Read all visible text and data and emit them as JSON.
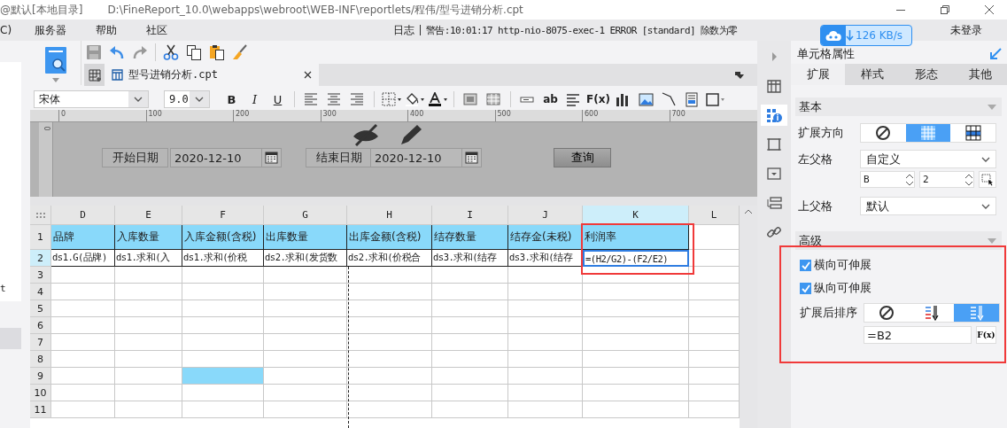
{
  "title_bar": {
    "workspace": "@默认[本地目录]",
    "path": "D:\\FineReport_10.0\\webapps\\webroot\\WEB-INF\\reportlets/程伟/型号进销分析.cpt"
  },
  "menu": [
    "C)",
    "服务器",
    "帮助",
    "社区"
  ],
  "log": {
    "label": "日志",
    "message": "警告:10:01:17 http-nio-8075-exec-1 ERROR [standard] 除数为零"
  },
  "upload_badge": {
    "speed": "126 KB/s"
  },
  "login": "未登录",
  "left_panel": {
    "text": "t"
  },
  "toolbar": [
    {
      "kind": "save"
    },
    {
      "kind": "undo"
    },
    {
      "kind": "redo"
    },
    {
      "kind": "separator"
    },
    {
      "kind": "cut"
    },
    {
      "kind": "copy"
    },
    {
      "kind": "paste"
    },
    {
      "kind": "brush"
    }
  ],
  "tabs": [
    {
      "label": "型号进销分析.cpt",
      "selected": true
    }
  ],
  "format_toolbar": {
    "font": "宋体",
    "size": "9.0",
    "items": [
      {
        "kind": "bold",
        "label": "B"
      },
      {
        "kind": "italic",
        "label": "I"
      },
      {
        "kind": "underline",
        "label": "U"
      },
      {
        "kind": "separator"
      },
      {
        "kind": "align-left"
      },
      {
        "kind": "align-center"
      },
      {
        "kind": "align-right"
      },
      {
        "kind": "separator"
      },
      {
        "kind": "border"
      },
      {
        "kind": "fill"
      },
      {
        "kind": "font-color"
      },
      {
        "kind": "separator"
      },
      {
        "kind": "merge"
      },
      {
        "kind": "table"
      },
      {
        "kind": "separator"
      },
      {
        "kind": "textbox"
      },
      {
        "kind": "text",
        "label": "ab"
      },
      {
        "kind": "lines"
      },
      {
        "kind": "text",
        "label": "F(x)"
      },
      {
        "kind": "chart"
      },
      {
        "kind": "image"
      },
      {
        "kind": "slash"
      },
      {
        "kind": "document"
      },
      {
        "kind": "frame"
      }
    ]
  },
  "ruler": [
    "0",
    "100",
    "200",
    "300",
    "400",
    "500",
    "600",
    "700"
  ],
  "vertical_ruler": "0",
  "parameters": [
    {
      "kind": "label",
      "text": "开始日期"
    },
    {
      "kind": "date",
      "value": "2020-12-10"
    },
    {
      "kind": "label",
      "text": "结束日期"
    },
    {
      "kind": "date",
      "value": "2020-12-10"
    },
    {
      "kind": "button",
      "text": "查询"
    }
  ],
  "grid": {
    "columns": [
      {
        "label": "D",
        "selected": false
      },
      {
        "label": "E",
        "selected": false
      },
      {
        "label": "F",
        "selected": false
      },
      {
        "label": "G",
        "selected": false
      },
      {
        "label": "H",
        "selected": false
      },
      {
        "label": "I",
        "selected": false
      },
      {
        "label": "J",
        "selected": false
      },
      {
        "label": "K",
        "selected": true
      },
      {
        "label": "L",
        "selected": false
      }
    ],
    "rows": [
      {
        "label": "1",
        "selected": false,
        "cells": [
          {
            "text": "品牌",
            "selected": false,
            "filled": true
          },
          {
            "text": "入库数量",
            "selected": false,
            "filled": true
          },
          {
            "text": "入库金额(含税)",
            "selected": false,
            "filled": true
          },
          {
            "text": "出库数量",
            "selected": false,
            "filled": true
          },
          {
            "text": "出库金额(含税)",
            "selected": false,
            "filled": true
          },
          {
            "text": "结存数量",
            "selected": false,
            "filled": true
          },
          {
            "text": "结存金(未税)",
            "selected": false,
            "filled": true
          },
          {
            "text": "利润率",
            "selected": false,
            "filled": true
          },
          {
            "selected": false,
            "filled": false
          }
        ]
      },
      {
        "label": "2",
        "selected": true,
        "cells": [
          {
            "text": "ds1.G(品牌)",
            "selected": false,
            "filled": false
          },
          {
            "text": "ds1.求和(入",
            "selected": false,
            "filled": false
          },
          {
            "text": "ds1.求和(价税",
            "selected": false,
            "filled": false
          },
          {
            "text": "ds2.求和(发货数",
            "selected": false,
            "filled": false
          },
          {
            "text": "ds2.求和(价税合",
            "selected": false,
            "filled": false
          },
          {
            "text": "ds3.求和(结存",
            "selected": false,
            "filled": false
          },
          {
            "text": "ds3.求和(结存",
            "selected": false,
            "filled": false
          },
          {
            "text": "=(H2/G2)-(F2/E2)",
            "selected": true,
            "filled": false
          },
          {
            "selected": false,
            "filled": false
          }
        ]
      },
      {
        "label": "3",
        "selected": false,
        "cells": [
          {
            "selected": false,
            "filled": false
          },
          {
            "selected": false,
            "filled": false
          },
          {
            "selected": false,
            "filled": false
          },
          {
            "selected": false,
            "filled": false
          },
          {
            "selected": false,
            "filled": false
          },
          {
            "selected": false,
            "filled": false
          },
          {
            "selected": false,
            "filled": false
          },
          {
            "selected": false,
            "filled": false
          },
          {
            "selected": false,
            "filled": false
          }
        ]
      },
      {
        "label": "4",
        "selected": false,
        "cells": [
          {
            "selected": false,
            "filled": false
          },
          {
            "selected": false,
            "filled": false
          },
          {
            "selected": false,
            "filled": false
          },
          {
            "selected": false,
            "filled": false
          },
          {
            "selected": false,
            "filled": false
          },
          {
            "selected": false,
            "filled": false
          },
          {
            "selected": false,
            "filled": false
          },
          {
            "selected": false,
            "filled": false
          },
          {
            "selected": false,
            "filled": false
          }
        ]
      },
      {
        "label": "5",
        "selected": false,
        "cells": [
          {
            "selected": false,
            "filled": false
          },
          {
            "selected": false,
            "filled": false
          },
          {
            "selected": false,
            "filled": false
          },
          {
            "selected": false,
            "filled": false
          },
          {
            "selected": false,
            "filled": false
          },
          {
            "selected": false,
            "filled": false
          },
          {
            "selected": false,
            "filled": false
          },
          {
            "selected": false,
            "filled": false
          },
          {
            "selected": false,
            "filled": false
          }
        ]
      },
      {
        "label": "6",
        "selected": false,
        "cells": [
          {
            "selected": false,
            "filled": false
          },
          {
            "selected": false,
            "filled": false
          },
          {
            "selected": false,
            "filled": false
          },
          {
            "selected": false,
            "filled": false
          },
          {
            "selected": false,
            "filled": false
          },
          {
            "selected": false,
            "filled": false
          },
          {
            "selected": false,
            "filled": false
          },
          {
            "selected": false,
            "filled": false
          },
          {
            "selected": false,
            "filled": false
          }
        ]
      },
      {
        "label": "7",
        "selected": false,
        "cells": [
          {
            "selected": false,
            "filled": false
          },
          {
            "selected": false,
            "filled": false
          },
          {
            "selected": false,
            "filled": false
          },
          {
            "selected": false,
            "filled": false
          },
          {
            "selected": false,
            "filled": false
          },
          {
            "selected": false,
            "filled": false
          },
          {
            "selected": false,
            "filled": false
          },
          {
            "selected": false,
            "filled": false
          },
          {
            "selected": false,
            "filled": false
          }
        ]
      },
      {
        "label": "8",
        "selected": false,
        "cells": [
          {
            "selected": false,
            "filled": false
          },
          {
            "selected": false,
            "filled": false
          },
          {
            "selected": false,
            "filled": false
          },
          {
            "selected": false,
            "filled": false
          },
          {
            "selected": false,
            "filled": false
          },
          {
            "selected": false,
            "filled": false
          },
          {
            "selected": false,
            "filled": false
          },
          {
            "selected": false,
            "filled": false
          },
          {
            "selected": false,
            "filled": false
          }
        ]
      },
      {
        "label": "9",
        "selected": false,
        "cells": [
          {
            "selected": false,
            "filled": false
          },
          {
            "selected": false,
            "filled": false
          },
          {
            "selected": false,
            "filled": true
          },
          {
            "selected": false,
            "filled": false
          },
          {
            "selected": false,
            "filled": false
          },
          {
            "selected": false,
            "filled": false
          },
          {
            "selected": false,
            "filled": false
          },
          {
            "selected": false,
            "filled": false
          },
          {
            "selected": false,
            "filled": false
          }
        ]
      },
      {
        "label": "10",
        "selected": false,
        "cells": [
          {
            "selected": false,
            "filled": false
          },
          {
            "selected": false,
            "filled": false
          },
          {
            "selected": false,
            "filled": false
          },
          {
            "selected": false,
            "filled": false
          },
          {
            "selected": false,
            "filled": false
          },
          {
            "selected": false,
            "filled": false
          },
          {
            "selected": false,
            "filled": false
          },
          {
            "selected": false,
            "filled": false
          },
          {
            "selected": false,
            "filled": false
          }
        ]
      },
      {
        "label": "11",
        "selected": false,
        "cells": [
          {
            "selected": false,
            "filled": false
          },
          {
            "selected": false,
            "filled": false
          },
          {
            "selected": false,
            "filled": false
          },
          {
            "selected": false,
            "filled": false
          },
          {
            "selected": false,
            "filled": false
          },
          {
            "selected": false,
            "filled": false
          },
          {
            "selected": false,
            "filled": false
          },
          {
            "selected": false,
            "filled": false
          },
          {
            "selected": false,
            "filled": false
          }
        ]
      }
    ]
  },
  "side_icons": [
    {
      "kind": "collapse",
      "selected": false
    },
    {
      "kind": "template",
      "selected": false
    },
    {
      "kind": "cell",
      "selected": true
    },
    {
      "kind": "border",
      "selected": false
    },
    {
      "kind": "widget",
      "selected": false
    },
    {
      "kind": "condition",
      "selected": false
    },
    {
      "kind": "link",
      "selected": false
    }
  ],
  "properties": {
    "title": "单元格属性",
    "tabs": [
      {
        "label": "扩展",
        "selected": true
      },
      {
        "label": "样式",
        "selected": false
      },
      {
        "label": "形态",
        "selected": false
      },
      {
        "label": "其他",
        "selected": false
      }
    ],
    "basic": {
      "title": "基本",
      "expand_direction": {
        "label": "扩展方向",
        "options": [
          {
            "kind": "none",
            "selected": false
          },
          {
            "kind": "vertical",
            "selected": true
          },
          {
            "kind": "horizontal",
            "selected": false
          }
        ]
      },
      "left_parent": {
        "label": "左父格",
        "value": "自定义",
        "column": "B",
        "row": "2"
      },
      "top_parent": {
        "label": "上父格",
        "value": "默认"
      }
    },
    "advanced": {
      "title": "高级",
      "checks": [
        {
          "label": "横向可伸展",
          "checked": true
        },
        {
          "label": "纵向可伸展",
          "checked": true
        }
      ],
      "sort": {
        "label": "扩展后排序",
        "options": [
          {
            "kind": "none",
            "selected": false
          },
          {
            "kind": "ascending",
            "selected": false
          },
          {
            "kind": "descending",
            "selected": true
          }
        ],
        "formula": "=B2",
        "formula_button": "F(x)"
      }
    }
  }
}
